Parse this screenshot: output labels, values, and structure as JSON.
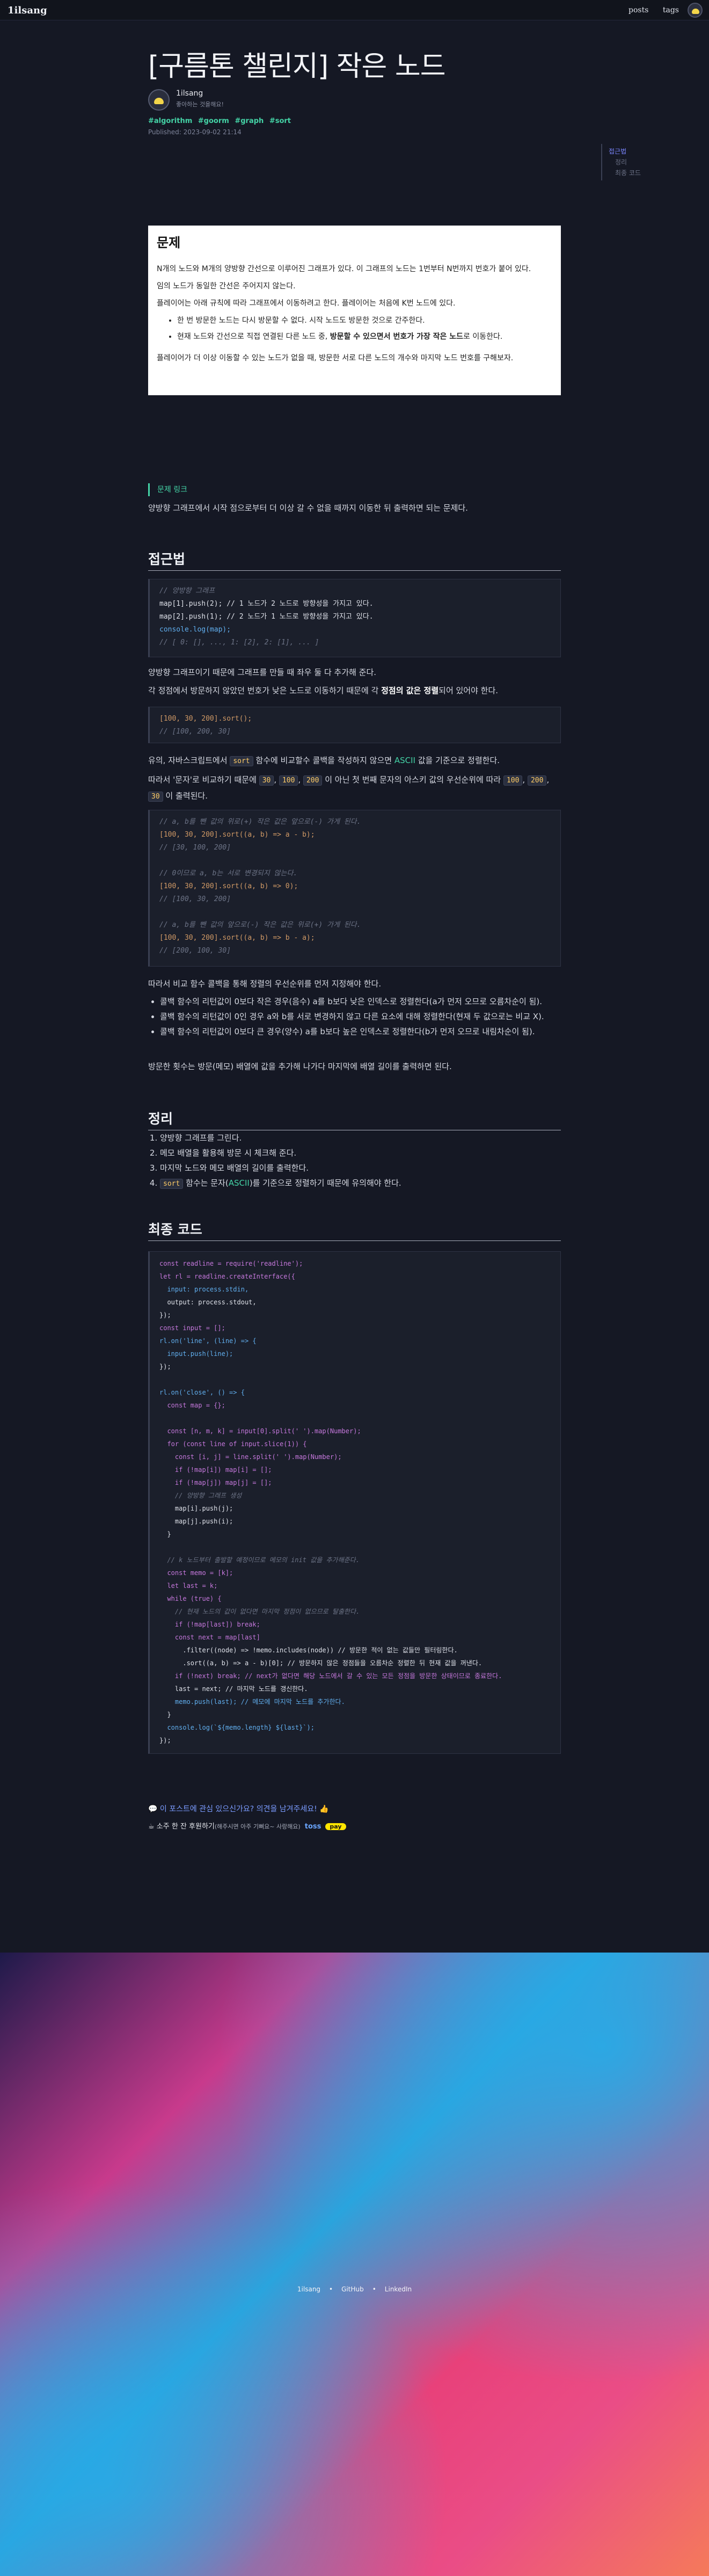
{
  "header": {
    "brand": "1ilsang",
    "nav": [
      "posts",
      "tags"
    ]
  },
  "article": {
    "title": "[구름톤 챌린지] 작은 노드",
    "author_name": "1ilsang",
    "author_bio": "좋아하는 것을해요!",
    "tags": [
      "#algorithm",
      "#goorm",
      "#graph",
      "#sort"
    ],
    "published": "Published: 2023-09-02 21:14"
  },
  "toc": {
    "items": [
      "접근법",
      "정리",
      "최종 코드"
    ]
  },
  "problem": {
    "heading": "문제",
    "p1": "N개의 노드와 M개의 양방향 간선으로 이루어진 그래프가 있다. 이 그래프의 노드는 1번부터 N번까지 번호가 붙어 있다.",
    "p2": "임의 노드가 동일한 간선은 주어지지 않는다.",
    "p3": "플레이어는 아래 규칙에 따라 그래프에서 이동하려고 한다. 플레이어는 처음에 K번 노드에 있다.",
    "li1": "한 번 방문한 노드는 다시 방문할 수 없다. 시작 노드도 방문한 것으로 간주한다.",
    "li2_a": "현재 노드와 간선으로 직접 연결된 다른 노드 중, ",
    "li2_b": "방문할 수 있으면서 번호가 가장 작은 노드",
    "li2_c": "로 이동한다.",
    "p4": "플레이어가 더 이상 이동할 수 있는 노드가 없을 때, 방문한 서로 다른 노드의 개수와 마지막 노드 번호를 구해보자."
  },
  "link": {
    "label": "문제 링크"
  },
  "intro": "양방향 그래프에서 시작 점으로부터 더 이상 갈 수 없을 때까지 이동한 뒤 출력하면 되는 문제다.",
  "approach": {
    "heading": "접근법",
    "code1": [
      "// 양방향 그래프",
      "map[1].push(2); // 1 노드가 2 노드로 방향성을 가지고 있다.",
      "map[2].push(1); // 2 노드가 1 노드로 방향성을 가지고 있다.",
      "console.log(map);",
      "// [ 0: [], ..., 1: [2], 2: [1], ... ]"
    ],
    "p1": "양방향 그래프이기 때문에 그래프를 만들 때 좌우 둘 다 추가해 준다.",
    "p2_a": "각 정점에서 방문하지 않았던 번호가 낮은 노드로 이동하기 때문에 각 ",
    "p2_b": "정점의 값은 정렬",
    "p2_c": "되어 있어야 한다.",
    "code2": [
      "[100, 30, 200].sort();",
      "// [100, 200, 30]"
    ],
    "p3_a": "유의, 자바스크립트에서 ",
    "p3_code": "sort",
    "p3_b": " 함수에 비교할수 콜백을 작성하지 않으면 ",
    "p3_c": "ASCII",
    "p3_d": " 값을 기준으로 정렬한다.",
    "p4_a": "따라서 '문자'로 비교하기 때문에 ",
    "p4_n1": "30",
    "p4_n2": "100",
    "p4_n3": "200",
    "p4_b": " 이 아닌 첫 번째 문자의 아스키 값의 우선순위에 따라 ",
    "p4_n4": "100",
    "p4_n5": "200",
    "p4_n6": "30",
    "p4_c": " 이 출력된다.",
    "code3": [
      "// a, b를 뺀 값의 위로(+) 작은 값은 앞으로(-) 가게 된다.",
      "[100, 30, 200].sort((a, b) => a - b);",
      "// [30, 100, 200]",
      "",
      "// 0이므로 a, b는 서로 변경되지 않는다.",
      "[100, 30, 200].sort((a, b) => 0);",
      "// [100, 30, 200]",
      "",
      "// a, b를 뺀 값의 앞으로(-) 작은 값은 위로(+) 가게 된다.",
      "[100, 30, 200].sort((a, b) => b - a);",
      "// [200, 100, 30]"
    ],
    "p5": "따라서 비교 함수 콜백을 통해 정렬의 우선순위를 먼저 지정해야 한다.",
    "li1": "콜백 함수의 리턴값이 0보다 작은 경우(음수) a를 b보다 낮은 인덱스로 정렬한다(a가 먼저 오므로 오름차순이 됨).",
    "li2": "콜백 함수의 리턴값이 0인 경우 a와 b를 서로 변경하지 않고 다른 요소에 대해 정렬한다(현재 두 값으로는 비교 X).",
    "li3": "콜백 함수의 리턴값이 0보다 큰 경우(양수) a를 b보다 높은 인덱스로 정렬한다(b가 먼저 오므로 내림차순이 됨).",
    "p6": "방문한 횟수는 방문(메모) 배열에 값을 추가해 나가다 마지막에 배열 길이를 출력하면 된다."
  },
  "summary": {
    "heading": "정리",
    "items": [
      "양방향 그래프를 그린다.",
      "메모 배열을 활용해 방문 시 체크해 준다.",
      "마지막 노드와 메모 배열의 길이를 출력한다."
    ],
    "item4_code": "sort",
    "item4_a": " 함수는 문자(",
    "item4_b": "ASCII",
    "item4_c": ")를 기준으로 정렬하기 때문에 유의해야 한다."
  },
  "final": {
    "heading": "최종 코드",
    "code": [
      "const readline = require('readline');",
      "let rl = readline.createInterface({",
      "  input: process.stdin,",
      "  output: process.stdout,",
      "});",
      "const input = [];",
      "rl.on('line', (line) => {",
      "  input.push(line);",
      "});",
      "",
      "rl.on('close', () => {",
      "  const map = {};",
      "",
      "  const [n, m, k] = input[0].split(' ').map(Number);",
      "  for (const line of input.slice(1)) {",
      "    const [i, j] = line.split(' ').map(Number);",
      "    if (!map[i]) map[i] = [];",
      "    if (!map[j]) map[j] = [];",
      "    // 양방향 그래프 생성",
      "    map[i].push(j);",
      "    map[j].push(i);",
      "  }",
      "",
      "  // k 노드부터 출발할 예정이므로 메모의 init 값을 추가해준다.",
      "  const memo = [k];",
      "  let last = k;",
      "  while (true) {",
      "    // 현재 노드의 값이 없다면 마지막 정점이 없으므로 탈출한다.",
      "    if (!map[last]) break;",
      "    const next = map[last]",
      "      .filter((node) => !memo.includes(node)) // 방문한 적이 없는 값들만 필터링한다.",
      "      .sort((a, b) => a - b)[0]; // 방문하지 않은 정점들을 오름차순 정렬한 뒤 현재 값을 꺼낸다.",
      "    if (!next) break; // next가 없다면 해당 노드에서 갈 수 있는 모든 정점을 방문한 상태이므로 종료한다.",
      "    last = next; // 마지막 노드를 갱신한다.",
      "    memo.push(last); // 메모에 마지막 노드를 추가한다.",
      "  }",
      "  console.log(`${memo.length} ${last}`);",
      "});"
    ]
  },
  "post_footer": {
    "feedback": "이 포스트에 관심 있으신가요? 의견을 남겨주세요!",
    "support_a": "소주 한 잔 후원하기",
    "support_b": "(해주시면 아주 기뻐요~ 사랑해요)",
    "toss": "toss",
    "pay": "pay"
  },
  "site_footer": {
    "links": [
      "1ilsang",
      "GitHub",
      "LinkedIn"
    ],
    "sep": "•"
  }
}
